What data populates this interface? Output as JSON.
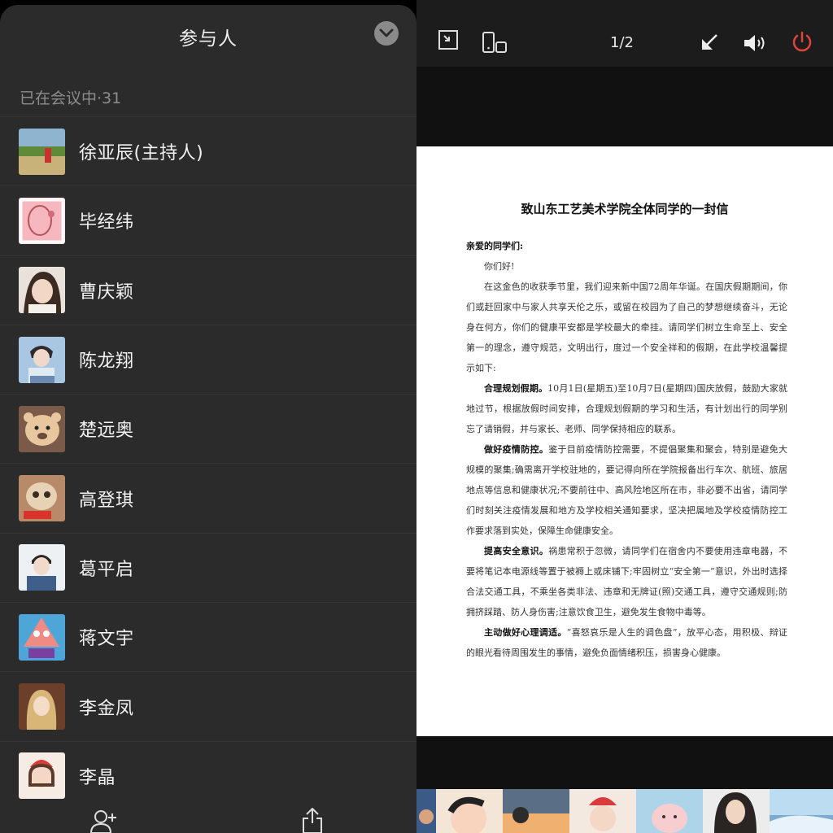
{
  "panel": {
    "title": "参与人",
    "section_label": "已在会议中·31",
    "participants": [
      {
        "name": "徐亚辰(主持人)"
      },
      {
        "name": "毕经纬"
      },
      {
        "name": "曹庆颖"
      },
      {
        "name": "陈龙翔"
      },
      {
        "name": "楚远奥"
      },
      {
        "name": "高登琪"
      },
      {
        "name": "葛平启"
      },
      {
        "name": "蒋文宇"
      },
      {
        "name": "李金凤"
      },
      {
        "name": "李晶"
      }
    ],
    "icons": {
      "collapse": "chevron-down-icon",
      "invite": "add-person-icon",
      "share": "share-icon"
    }
  },
  "viewer": {
    "page_indicator": "1/2",
    "icons": [
      "exit-fullscreen-icon",
      "rotate-screen-icon",
      "minimize-arrow-icon",
      "speaker-icon",
      "power-icon"
    ],
    "power_color": "#e0433a",
    "document": {
      "title": "致山东工艺美术学院全体同学的一封信",
      "salutation": "亲爱的同学们:",
      "greeting": "你们好!",
      "p1": "在这金色的收获季节里，我们迎来新中国72周年华诞。在国庆假期期间，你们或赶回家中与家人共享天伦之乐，或留在校园为了自己的梦想继续奋斗，无论身在何方，你们的健康平安都是学校最大的牵挂。请同学们树立生命至上、安全第一的理念，遵守规范，文明出行，度过一个安全祥和的假期，在此学校温馨提示如下:",
      "p2_bold": "合理规划假期。",
      "p2": "10月1日(星期五)至10月7日(星期四)国庆放假，鼓励大家就地过节，根据放假时间安排，合理规划假期的学习和生活，有计划出行的同学别忘了请销假，并与家长、老师、同学保持相应的联系。",
      "p3_bold": "做好疫情防控。",
      "p3": "鉴于目前疫情防控需要，不提倡聚集和聚会，特别是避免大规模的聚集;确需离开学校驻地的，要记得向所在学院报备出行车次、航班、旅居地点等信息和健康状况;不要前往中、高风险地区所在市，非必要不出省，请同学们时刻关注疫情发展和地方及学校相关通知要求，坚决把属地及学校疫情防控工作要求落到实处，保障生命健康安全。",
      "p4_bold": "提高安全意识。",
      "p4": "祸患常积于忽微，请同学们在宿舍内不要使用违章电器，不要将笔记本电源线等置于被褥上或床铺下;牢固树立“安全第一”意识，外出时选择合法交通工具，不乘坐各类非法、违章和无牌证(照)交通工具，遵守交通规则;防拥挤踩踏、防人身伤害;注意饮食卫生，避免发生食物中毒等。",
      "p5_bold": "主动做好心理调适。",
      "p5": "“喜怒哀乐是人生的调色盘”，放平心态，用积极、辩证的眼光看待周围发生的事情，避免负面情绪积压，损害身心健康。"
    }
  }
}
